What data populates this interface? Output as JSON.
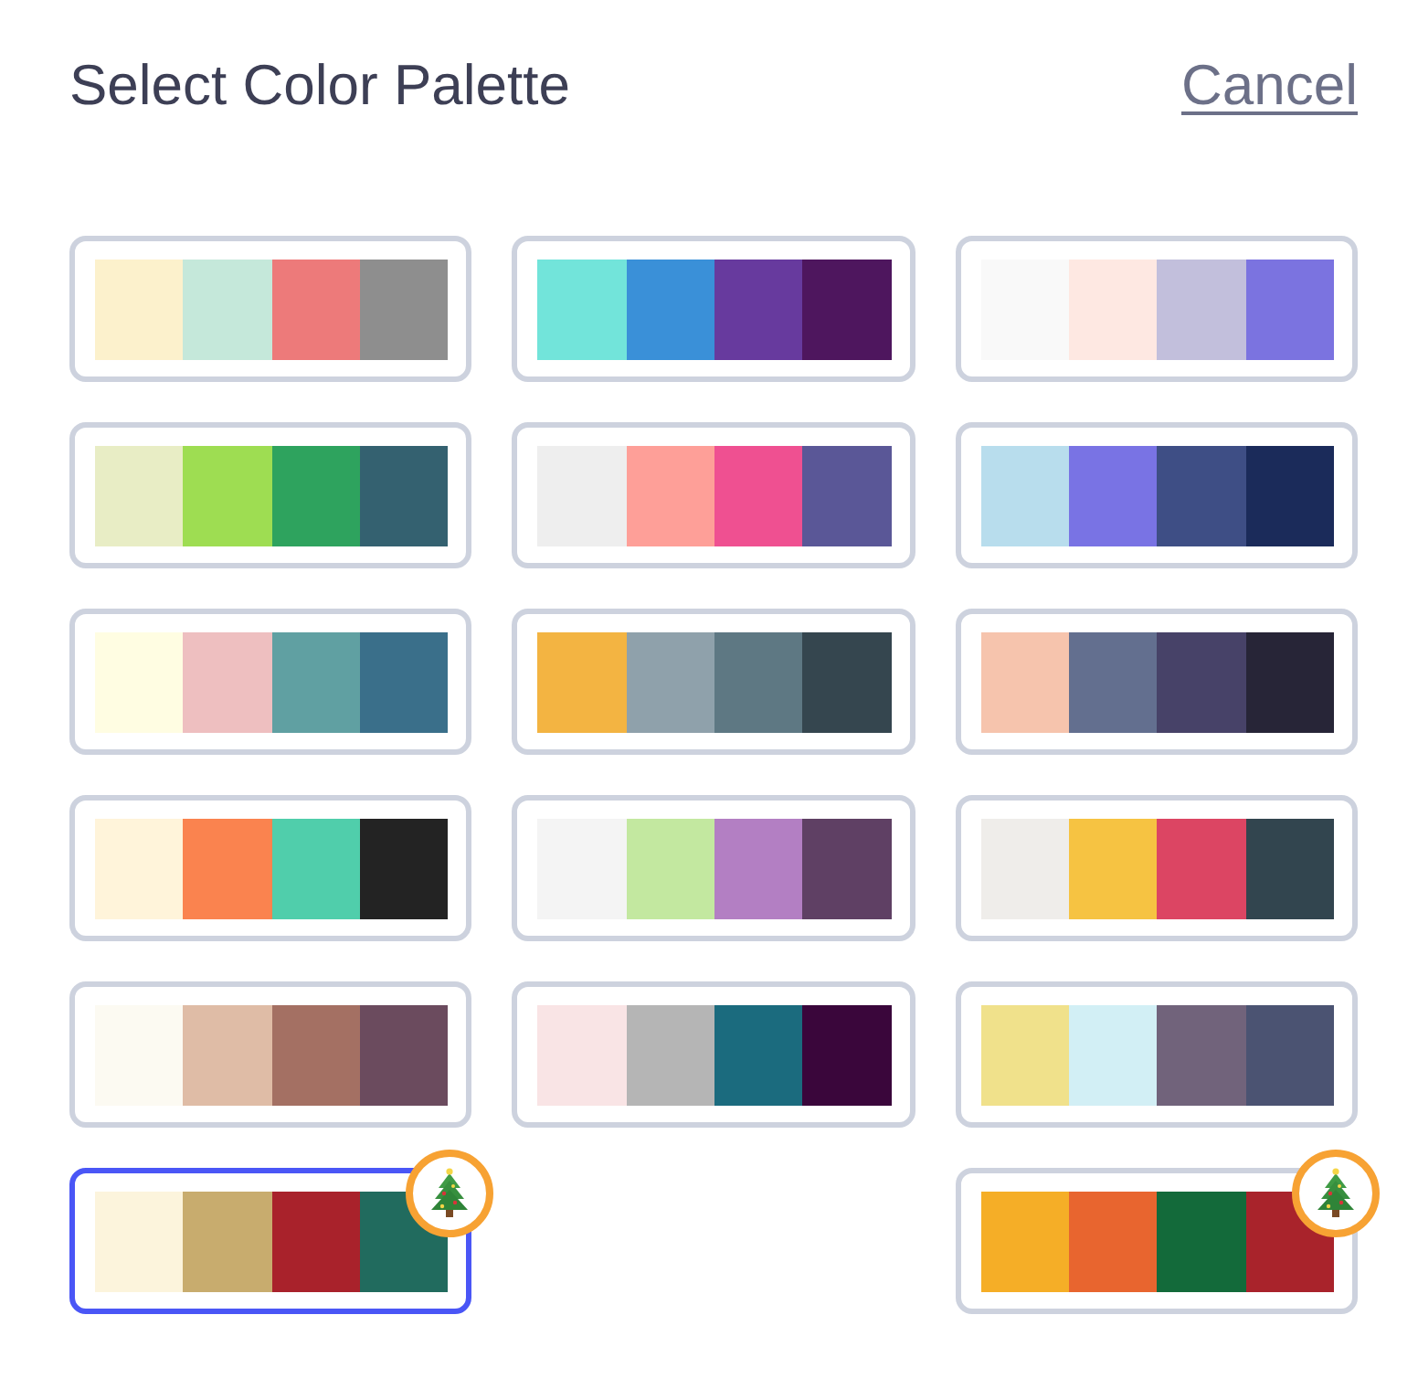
{
  "header": {
    "title": "Select Color Palette",
    "cancel": "Cancel"
  },
  "columns": [
    {
      "palettes": [
        {
          "swatches": [
            {
              "color": "#fcf1cc"
            },
            {
              "color": "#c5e8da"
            },
            {
              "color": "#ed7a7a"
            },
            {
              "color": "#8e8e8e"
            }
          ],
          "selected": false,
          "holiday_badge": false
        },
        {
          "swatches": [
            {
              "color": "#e8edc5"
            },
            {
              "color": "#9edd52"
            },
            {
              "color": "#2ea35e"
            },
            {
              "color": "#346170"
            }
          ],
          "selected": false,
          "holiday_badge": false
        },
        {
          "swatches": [
            {
              "color": "#fffde2"
            },
            {
              "color": "#eebfc0"
            },
            {
              "color": "#60a0a2"
            },
            {
              "color": "#3a6f8a"
            }
          ],
          "selected": false,
          "holiday_badge": false
        },
        {
          "swatches": [
            {
              "color": "#fff4da"
            },
            {
              "color": "#fa834f"
            },
            {
              "color": "#50ceab"
            },
            {
              "color": "#232323"
            }
          ],
          "selected": false,
          "holiday_badge": false
        },
        {
          "swatches": [
            {
              "color": "#fcfaf2"
            },
            {
              "color": "#dfbca6"
            },
            {
              "color": "#a47063"
            },
            {
              "color": "#6b4b5e"
            }
          ],
          "selected": false,
          "holiday_badge": false
        },
        {
          "swatches": [
            {
              "color": "#fcf4dc"
            },
            {
              "color": "#c8ac6e"
            },
            {
              "color": "#a9222b"
            },
            {
              "color": "#216b5e"
            }
          ],
          "selected": true,
          "holiday_badge": true
        }
      ]
    },
    {
      "palettes": [
        {
          "swatches": [
            {
              "color": "#72e4da"
            },
            {
              "color": "#3a90d8"
            },
            {
              "color": "#673a9e"
            },
            {
              "color": "#4e165e"
            }
          ],
          "selected": false,
          "holiday_badge": false
        },
        {
          "swatches": [
            {
              "color": "#eeeeee"
            },
            {
              "color": "#fe9f98"
            },
            {
              "color": "#ef5091"
            },
            {
              "color": "#5a5797"
            }
          ],
          "selected": false,
          "holiday_badge": false
        },
        {
          "swatches": [
            {
              "color": "#f3b442"
            },
            {
              "color": "#8fa1ab"
            },
            {
              "color": "#5e7883"
            },
            {
              "color": "#35464f"
            }
          ],
          "selected": false,
          "holiday_badge": false
        },
        {
          "swatches": [
            {
              "color": "#f4f4f4"
            },
            {
              "color": "#c3e8a0"
            },
            {
              "color": "#b37fc3"
            },
            {
              "color": "#5f4064"
            }
          ],
          "selected": false,
          "holiday_badge": false
        },
        {
          "swatches": [
            {
              "color": "#f9e4e5"
            },
            {
              "color": "#b5b5b5"
            },
            {
              "color": "#1b6b7e"
            },
            {
              "color": "#3a063b"
            }
          ],
          "selected": false,
          "holiday_badge": false
        }
      ]
    },
    {
      "palettes": [
        {
          "swatches": [
            {
              "color": "#f9f9f9"
            },
            {
              "color": "#fee8e2"
            },
            {
              "color": "#c2bfdc"
            },
            {
              "color": "#7b73e0"
            }
          ],
          "selected": false,
          "holiday_badge": false
        },
        {
          "swatches": [
            {
              "color": "#b8dded"
            },
            {
              "color": "#7973e4"
            },
            {
              "color": "#3e4e85"
            },
            {
              "color": "#1b2b5a"
            }
          ],
          "selected": false,
          "holiday_badge": false
        },
        {
          "swatches": [
            {
              "color": "#f6c4ad"
            },
            {
              "color": "#636f8f"
            },
            {
              "color": "#474268"
            },
            {
              "color": "#272537"
            }
          ],
          "selected": false,
          "holiday_badge": false
        },
        {
          "swatches": [
            {
              "color": "#efedea"
            },
            {
              "color": "#f6c342"
            },
            {
              "color": "#dc4563"
            },
            {
              "color": "#32454f"
            }
          ],
          "selected": false,
          "holiday_badge": false
        },
        {
          "swatches": [
            {
              "color": "#f0e18b"
            },
            {
              "color": "#d2eff5"
            },
            {
              "color": "#71637b"
            },
            {
              "color": "#4b5372"
            }
          ],
          "selected": false,
          "holiday_badge": false
        },
        {
          "swatches": [
            {
              "color": "#f5ae27"
            },
            {
              "color": "#e8652f"
            },
            {
              "color": "#136a3a"
            },
            {
              "color": "#a9232b"
            }
          ],
          "selected": false,
          "holiday_badge": true
        }
      ]
    }
  ]
}
